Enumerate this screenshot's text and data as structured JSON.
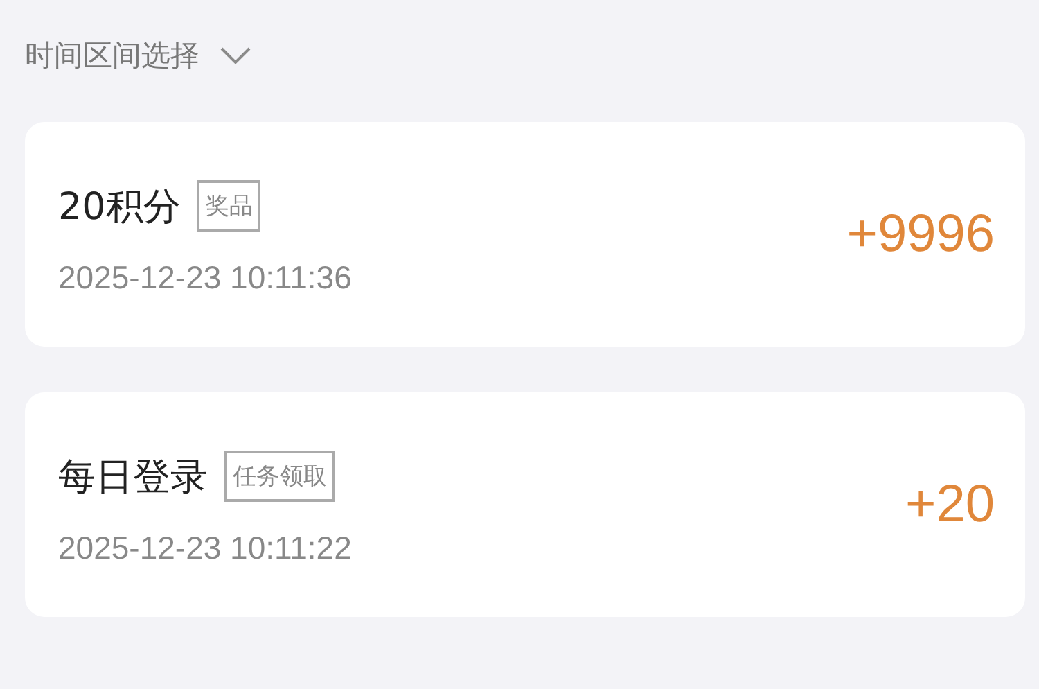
{
  "filter": {
    "label": "时间区间选择"
  },
  "records": [
    {
      "title": "20积分",
      "tag": "奖品",
      "time": "2025-12-23 10:11:36",
      "amount": "+9996"
    },
    {
      "title": "每日登录",
      "tag": "任务领取",
      "time": "2025-12-23 10:11:22",
      "amount": "+20"
    }
  ]
}
